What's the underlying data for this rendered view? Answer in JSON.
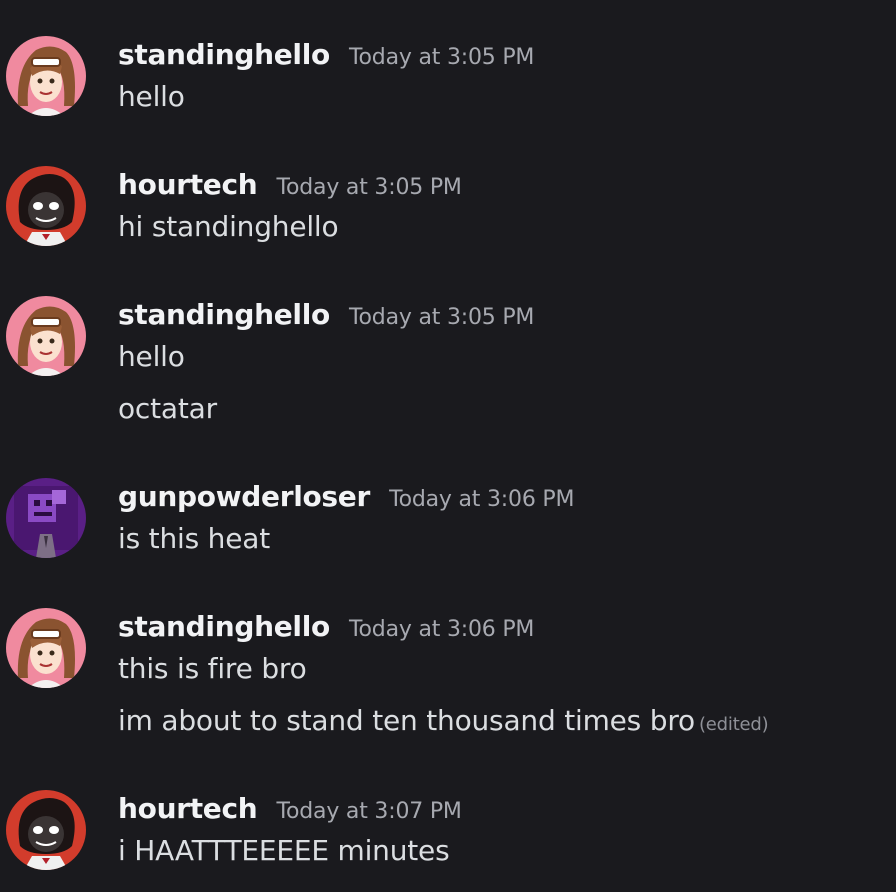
{
  "messages": [
    {
      "username": "standinghello",
      "timestamp": "Today at 3:05 PM",
      "avatar_icon": "anime-girl-avatar-icon",
      "avatar_bg": "#f08a9f",
      "lines": [
        "hello"
      ]
    },
    {
      "username": "hourtech",
      "timestamp": "Today at 3:05 PM",
      "avatar_icon": "dark-character-avatar-icon",
      "avatar_bg": "#d23c2c",
      "lines": [
        "hi standinghello"
      ]
    },
    {
      "username": "standinghello",
      "timestamp": "Today at 3:05 PM",
      "avatar_icon": "anime-girl-avatar-icon",
      "avatar_bg": "#f08a9f",
      "lines": [
        "hello",
        "octatar"
      ]
    },
    {
      "username": "gunpowderloser",
      "timestamp": "Today at 3:06 PM",
      "avatar_icon": "purple-pixel-avatar-icon",
      "avatar_bg": "#5a1f86",
      "lines": [
        "is this heat"
      ]
    },
    {
      "username": "standinghello",
      "timestamp": "Today at 3:06 PM",
      "avatar_icon": "anime-girl-avatar-icon",
      "avatar_bg": "#f08a9f",
      "lines": [
        "this is fire bro",
        "im about to stand ten thousand times bro"
      ],
      "edited_label": "(edited)"
    },
    {
      "username": "hourtech",
      "timestamp": "Today at 3:07 PM",
      "avatar_icon": "dark-character-avatar-icon",
      "avatar_bg": "#d23c2c",
      "lines": [
        "i HAATTTEEEEE minutes"
      ]
    }
  ],
  "colors": {
    "background": "#1a1a1e",
    "username": "#f2f3f5",
    "timestamp": "#a7a9b0",
    "message_text": "#dbdee1",
    "edited": "#8e9097"
  }
}
